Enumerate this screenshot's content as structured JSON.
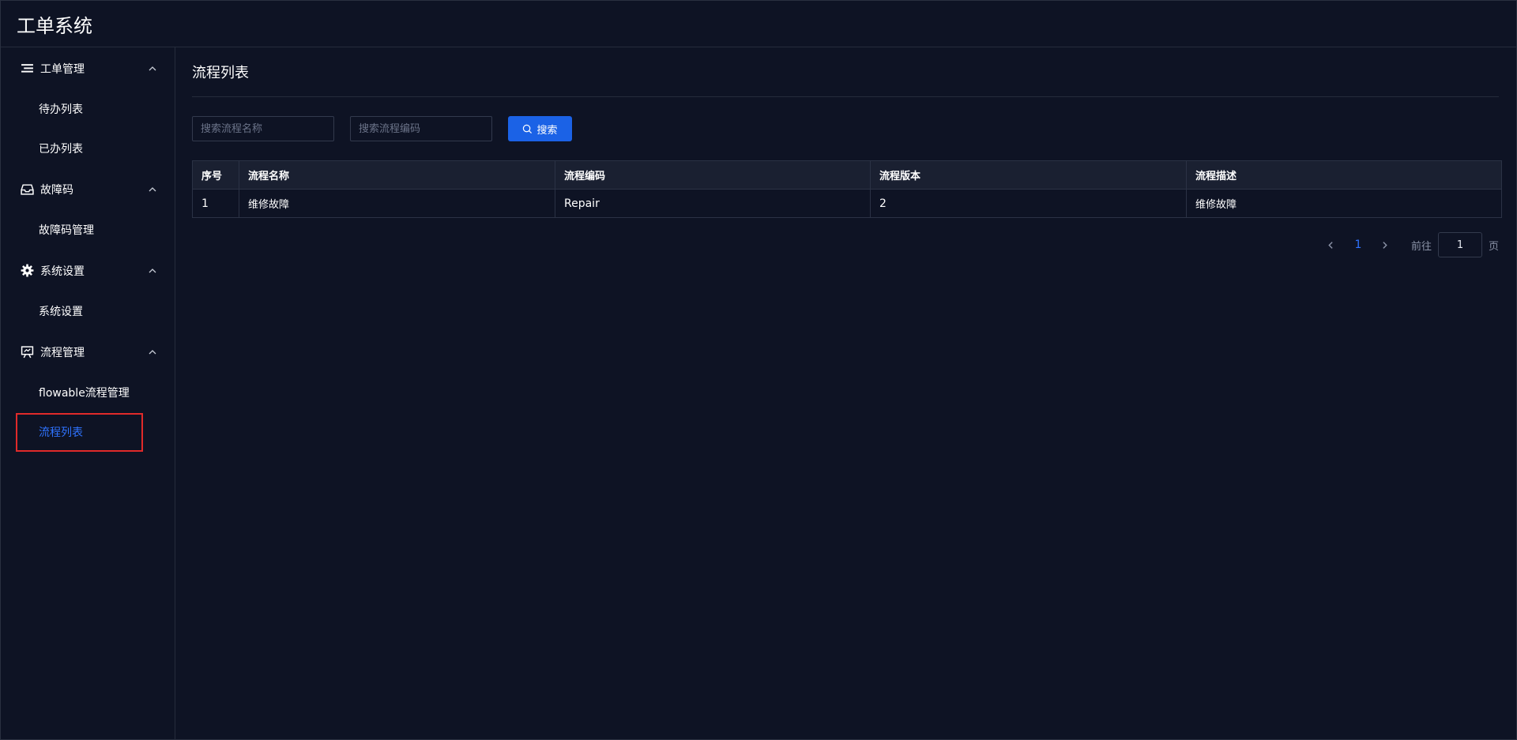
{
  "app": {
    "title": "工单系统"
  },
  "sidebar": {
    "groups": [
      {
        "label": "工单管理",
        "icon": "list-icon",
        "items": [
          {
            "label": "待办列表"
          },
          {
            "label": "已办列表"
          }
        ]
      },
      {
        "label": "故障码",
        "icon": "inbox-icon",
        "items": [
          {
            "label": "故障码管理"
          }
        ]
      },
      {
        "label": "系统设置",
        "icon": "gear-icon",
        "items": [
          {
            "label": "系统设置"
          }
        ]
      },
      {
        "label": "流程管理",
        "icon": "presentation-icon",
        "items": [
          {
            "label": "flowable流程管理"
          },
          {
            "label": "流程列表",
            "active": true
          }
        ]
      }
    ]
  },
  "main": {
    "title": "流程列表",
    "search": {
      "name_placeholder": "搜索流程名称",
      "code_placeholder": "搜索流程编码",
      "button_label": "搜索"
    },
    "table": {
      "columns": [
        "序号",
        "流程名称",
        "流程编码",
        "流程版本",
        "流程描述"
      ],
      "rows": [
        [
          "1",
          "维修故障",
          "Repair",
          "2",
          "维修故障"
        ]
      ]
    },
    "pagination": {
      "current_page": "1",
      "goto_label": "前往",
      "goto_value": "1",
      "page_suffix": "页"
    }
  },
  "colors": {
    "background": "#0e1324",
    "accent": "#1b62e6",
    "active_text": "#2f73ff",
    "highlight_border": "#e02a2a"
  }
}
